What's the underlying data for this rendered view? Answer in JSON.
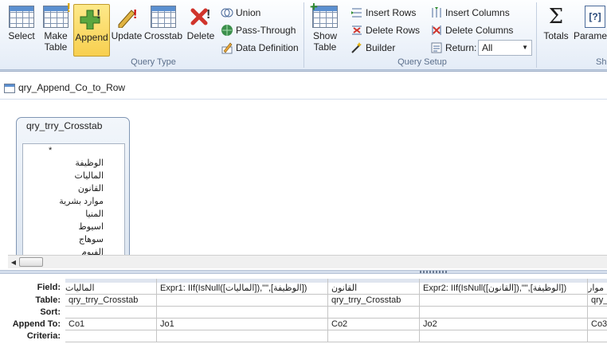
{
  "ribbon": {
    "query_type": {
      "label": "Query Type",
      "buttons": {
        "select": "Select",
        "make_table_1": "Make",
        "make_table_2": "Table",
        "append": "Append",
        "update": "Update",
        "crosstab": "Crosstab",
        "delete": "Delete"
      },
      "small_buttons": [
        "Union",
        "Pass-Through",
        "Data Definition"
      ]
    },
    "query_setup": {
      "label": "Query Setup",
      "show_table_1": "Show",
      "show_table_2": "Table",
      "insert_rows": "Insert Rows",
      "delete_rows": "Delete Rows",
      "builder": "Builder",
      "insert_columns": "Insert Columns",
      "delete_columns": "Delete Columns",
      "return_label": "Return:",
      "return_value": "All"
    },
    "show_hide": {
      "totals": "Totals",
      "parameters": "Paramet",
      "label_partial": "Sh"
    }
  },
  "document": {
    "title": "qry_Append_Co_to_Row"
  },
  "table_box": {
    "title": "qry_trry_Crosstab",
    "fields": [
      "*",
      "الوظيفة",
      "الماليات",
      "القانون",
      "موارد بشرية",
      "المنيا",
      "اسيوط",
      "سوهاج",
      "الفيوم"
    ]
  },
  "grid": {
    "row_labels": [
      "Field:",
      "Table:",
      "Sort:",
      "Append To:",
      "Criteria:"
    ],
    "columns": [
      {
        "field": "الماليات",
        "table": "qry_trry_Crosstab",
        "sort": "",
        "append_to": "Co1",
        "criteria": ""
      },
      {
        "field": "Expr1: IIf(IsNull([الماليات]),\"\",[الوظيفة])",
        "table": "",
        "sort": "",
        "append_to": "Jo1",
        "criteria": ""
      },
      {
        "field": "القانون",
        "table": "qry_trry_Crosstab",
        "sort": "",
        "append_to": "Co2",
        "criteria": ""
      },
      {
        "field": "Expr2: IIf(IsNull([القانون]),\"\",[الوظيفة])",
        "table": "",
        "sort": "",
        "append_to": "Jo2",
        "criteria": ""
      },
      {
        "field": "موارد بشرية",
        "table": "qry_trry_Crosstab",
        "sort": "",
        "append_to": "Co3",
        "criteria": ""
      }
    ]
  },
  "colors": {
    "ribbon_bg": "#e4ecf7",
    "active_button": "#f8cf4f",
    "group_label": "#5b6f8b",
    "workspace": "#c8d4e4"
  }
}
